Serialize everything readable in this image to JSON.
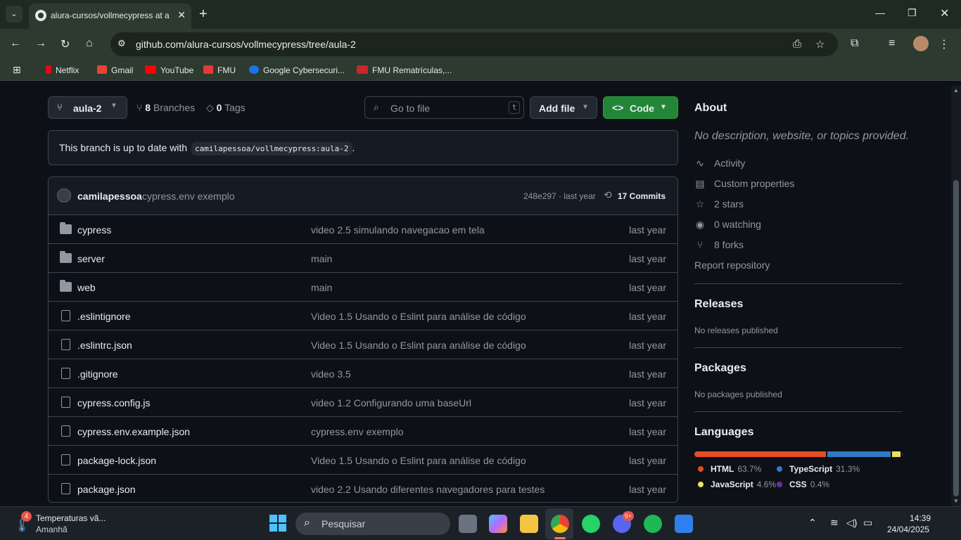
{
  "browser": {
    "tab_title": "alura-cursos/vollmecypress at a",
    "url": "github.com/alura-cursos/vollmecypress/tree/aula-2",
    "bookmarks": [
      "Netflix",
      "Gmail",
      "YouTube",
      "FMU",
      "Google Cybersecuri...",
      "FMU Rematrículas,..."
    ],
    "bookmark_colors": [
      "#e50914",
      "#ea4335",
      "#ff0000",
      "#e53935",
      "#1a73e8",
      "#c62828"
    ]
  },
  "repo": {
    "branch": "aula-2",
    "branches_count": "8",
    "branches_label": "Branches",
    "tags_count": "0",
    "tags_label": "Tags",
    "goto_placeholder": "Go to file",
    "goto_key": "t",
    "add_file_label": "Add file",
    "code_label": "Code",
    "branch_status_text": "This branch is up to date with",
    "branch_status_ref": "camilapessoa/vollmecypress:aula-2",
    "branch_status_end": ".",
    "last_commit": {
      "author": "camilapessoa",
      "message": "cypress.env exemplo",
      "sha_age": "248e297 · last year",
      "commits_label": "17 Commits"
    },
    "files": [
      {
        "type": "folder",
        "name": "cypress",
        "message": "video 2.5 simulando navegacao em tela",
        "age": "last year"
      },
      {
        "type": "folder",
        "name": "server",
        "message": "main",
        "age": "last year"
      },
      {
        "type": "folder",
        "name": "web",
        "message": "main",
        "age": "last year"
      },
      {
        "type": "file",
        "name": ".eslintignore",
        "message": "Video 1.5 Usando o Eslint para análise de código",
        "age": "last year"
      },
      {
        "type": "file",
        "name": ".eslintrc.json",
        "message": "Video 1.5 Usando o Eslint para análise de código",
        "age": "last year"
      },
      {
        "type": "file",
        "name": ".gitignore",
        "message": "video 3.5",
        "age": "last year"
      },
      {
        "type": "file",
        "name": "cypress.config.js",
        "message": "video 1.2 Configurando uma baseUrl",
        "age": "last year"
      },
      {
        "type": "file",
        "name": "cypress.env.example.json",
        "message": "cypress.env exemplo",
        "age": "last year"
      },
      {
        "type": "file",
        "name": "package-lock.json",
        "message": "Video 1.5 Usando o Eslint para análise de código",
        "age": "last year"
      },
      {
        "type": "file",
        "name": "package.json",
        "message": "video 2.2 Usando diferentes navegadores para testes",
        "age": "last year"
      }
    ]
  },
  "about": {
    "title": "About",
    "description": "No description, website, or topics provided.",
    "items": [
      {
        "icon": "activity-icon",
        "label": "Activity"
      },
      {
        "icon": "custom-properties-icon",
        "label": "Custom properties"
      },
      {
        "icon": "star-icon",
        "label": "2 stars"
      },
      {
        "icon": "eye-icon",
        "label": "0 watching"
      },
      {
        "icon": "fork-icon",
        "label": "8 forks"
      }
    ],
    "report": "Report repository"
  },
  "releases": {
    "title": "Releases",
    "text": "No releases published"
  },
  "packages": {
    "title": "Packages",
    "text": "No packages published"
  },
  "languages": {
    "title": "Languages",
    "items": [
      {
        "name": "HTML",
        "pct": "63.7%",
        "value": 63.7,
        "color": "#e34c26"
      },
      {
        "name": "TypeScript",
        "pct": "31.3%",
        "value": 31.3,
        "color": "#3178c6"
      },
      {
        "name": "JavaScript",
        "pct": "4.6%",
        "value": 4.6,
        "color": "#f1e05a"
      },
      {
        "name": "CSS",
        "pct": "0.4%",
        "value": 0.4,
        "color": "#663399"
      }
    ]
  },
  "taskbar": {
    "weather_title": "Temperaturas vã...",
    "weather_sub": "Amanhã",
    "weather_badge": "4",
    "search_placeholder": "Pesquisar",
    "discord_badge": "9+",
    "time": "14:39",
    "date": "24/04/2025"
  }
}
